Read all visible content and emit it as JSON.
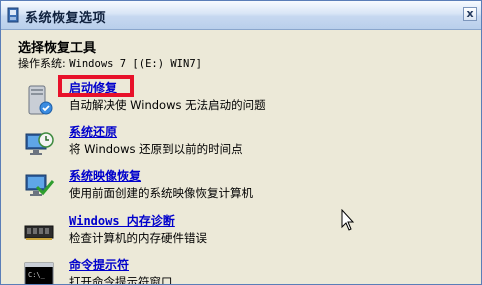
{
  "window": {
    "title": "系统恢复选项",
    "close_label": "x"
  },
  "main": {
    "heading": "选择恢复工具",
    "os_label": "操作系统:",
    "os_value": "Windows 7 [(E:) WIN7]"
  },
  "tools": [
    {
      "icon": "startup-repair-icon",
      "title": "启动修复",
      "desc": "自动解决使 Windows 无法启动的问题"
    },
    {
      "icon": "system-restore-icon",
      "title": "系统还原",
      "desc": "将 Windows 还原到以前的时间点"
    },
    {
      "icon": "system-image-recovery-icon",
      "title": "系统映像恢复",
      "desc": "使用前面创建的系统映像恢复计算机"
    },
    {
      "icon": "memory-diagnostic-icon",
      "title": "Windows 内存诊断",
      "desc": "检查计算机的内存硬件错误"
    },
    {
      "icon": "command-prompt-icon",
      "title": "命令提示符",
      "desc": "打开命令提示符窗口"
    }
  ],
  "colors": {
    "link": "#0000cc",
    "highlight_box": "#e8112a"
  }
}
